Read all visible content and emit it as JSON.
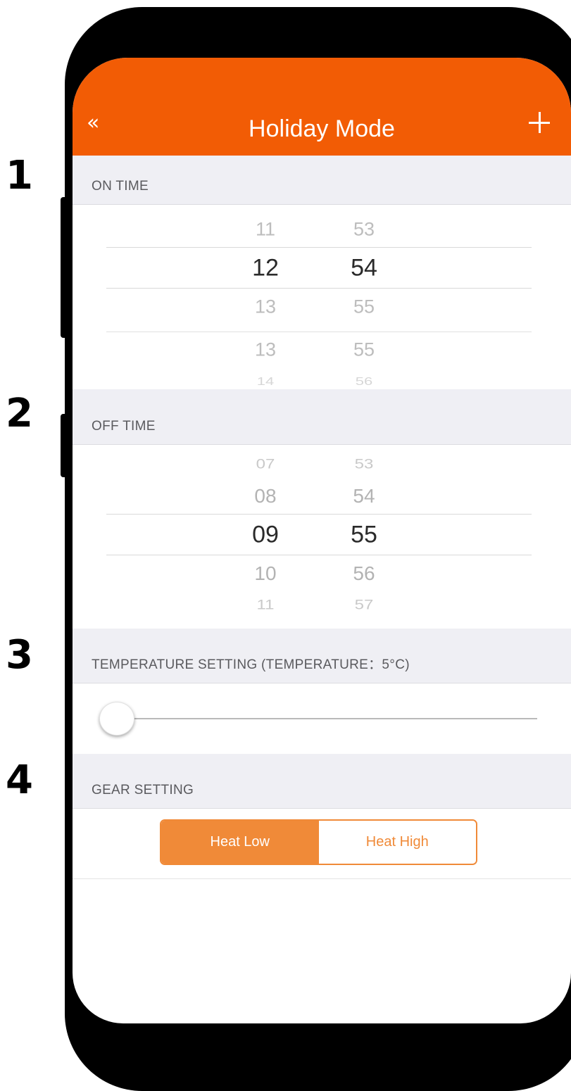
{
  "step_numbers": [
    "1",
    "2",
    "3",
    "4"
  ],
  "header": {
    "back_icon": "double-chevron-left-icon",
    "back_glyph": "«",
    "title": "Holiday Mode",
    "add_icon": "plus-icon"
  },
  "on_time": {
    "label": "ON TIME",
    "hours": [
      "11",
      "12",
      "13",
      "13",
      "14"
    ],
    "minutes": [
      "53",
      "54",
      "55",
      "55",
      "56"
    ],
    "selected_hour": "12",
    "selected_minute": "54"
  },
  "off_time": {
    "label": "OFF TIME",
    "hours": [
      "07",
      "08",
      "09",
      "10",
      "11"
    ],
    "minutes": [
      "53",
      "54",
      "55",
      "56",
      "57"
    ],
    "selected_hour": "09",
    "selected_minute": "55"
  },
  "temperature": {
    "label": "TEMPERATURE SETTING (TEMPERATURE：5°C)",
    "slider_fraction": 0
  },
  "gear": {
    "label": "GEAR SETTING",
    "options": [
      "Heat Low",
      "Heat High"
    ],
    "selected": "Heat Low"
  },
  "colors": {
    "accent": "#f25c05",
    "segment": "#f08a38",
    "section_bg": "#efeff4"
  }
}
